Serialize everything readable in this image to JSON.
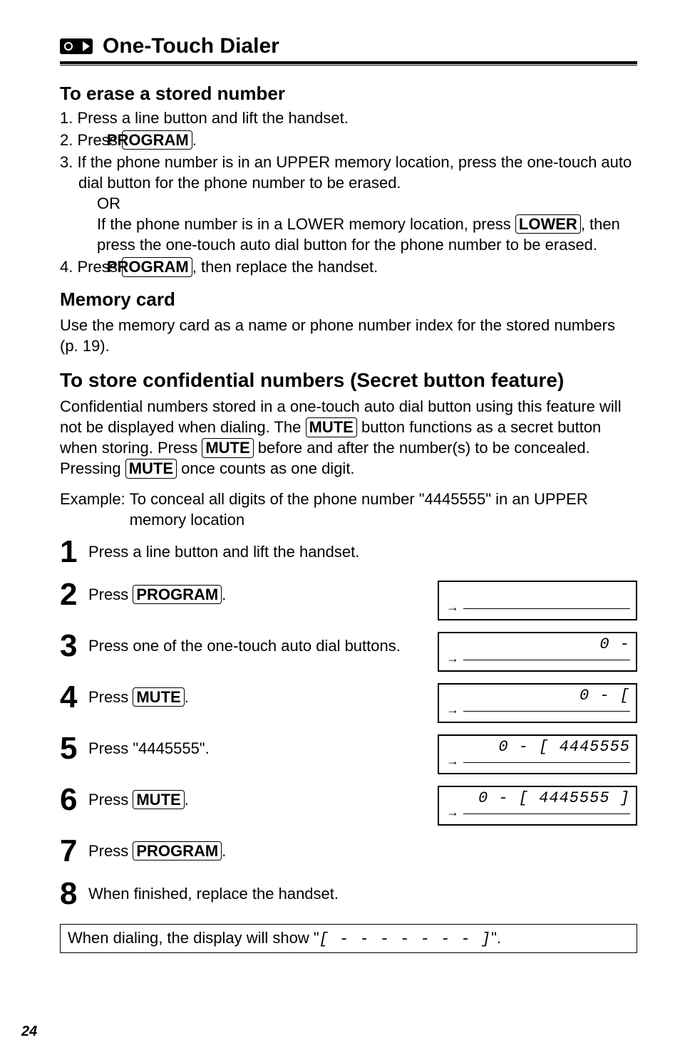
{
  "header": {
    "icon": "tape-arrow-icon",
    "title": "One-Touch Dialer"
  },
  "erase": {
    "heading": "To erase a stored number",
    "items": [
      {
        "num": "1.",
        "text": "Press a line button and lift the handset."
      },
      {
        "num": "2.",
        "pre": "Press ",
        "btn": "PROGRAM",
        "post": "."
      },
      {
        "num": "3.",
        "l1": "If the phone number is in an UPPER memory location, press the one-touch auto dial button for the phone number to be erased.",
        "or": "OR",
        "l2a": "If the phone number is in a LOWER memory location, press ",
        "l2btn": "LOWER",
        "l2b": ", then press the one-touch auto dial button for the phone number to be erased."
      },
      {
        "num": "4.",
        "pre": "Press ",
        "btn": "PROGRAM",
        "post": ", then replace the handset."
      }
    ]
  },
  "memory": {
    "heading": "Memory card",
    "text": "Use the memory card as a name or phone number index for the stored numbers (p. 19)."
  },
  "secret": {
    "heading": "To store confidential numbers (Secret button feature)",
    "p1a": "Confidential numbers stored in a one-touch auto dial button using this feature will not be displayed when dialing. The ",
    "btn1": "MUTE",
    "p1b": " button functions as a secret button when storing. Press ",
    "btn2": "MUTE",
    "p1c": " before and after the number(s) to be concealed. Pressing ",
    "btn3": "MUTE",
    "p1d": " once counts as one digit.",
    "example_label": "Example:",
    "example_text": "To conceal all digits of the phone number \"4445555\" in an UPPER memory location"
  },
  "steps": [
    {
      "n": "1",
      "text": "Press a line button and lift the handset."
    },
    {
      "n": "2",
      "pre": "Press ",
      "btn": "PROGRAM",
      "post": ".",
      "disp": {
        "top": "",
        "blank": true
      }
    },
    {
      "n": "3",
      "text": "Press one of the one-touch auto dial buttons.",
      "disp": {
        "top": "0 -"
      }
    },
    {
      "n": "4",
      "pre": "Press ",
      "btn": "MUTE",
      "post": ".",
      "disp": {
        "top": "0 - ["
      }
    },
    {
      "n": "5",
      "text": "Press \"4445555\".",
      "disp": {
        "top": "0 - [ 4445555"
      }
    },
    {
      "n": "6",
      "pre": "Press ",
      "btn": "MUTE",
      "post": ".",
      "disp": {
        "top": "0 - [ 4445555 ]"
      }
    },
    {
      "n": "7",
      "pre": "Press ",
      "btn": "PROGRAM",
      "post": "."
    },
    {
      "n": "8",
      "text": "When finished, replace the handset."
    }
  ],
  "note": {
    "pre": "When dialing, the display will show \"",
    "seg": "[ - - - - - - - ]",
    "post": "\"."
  },
  "page_number": "24"
}
